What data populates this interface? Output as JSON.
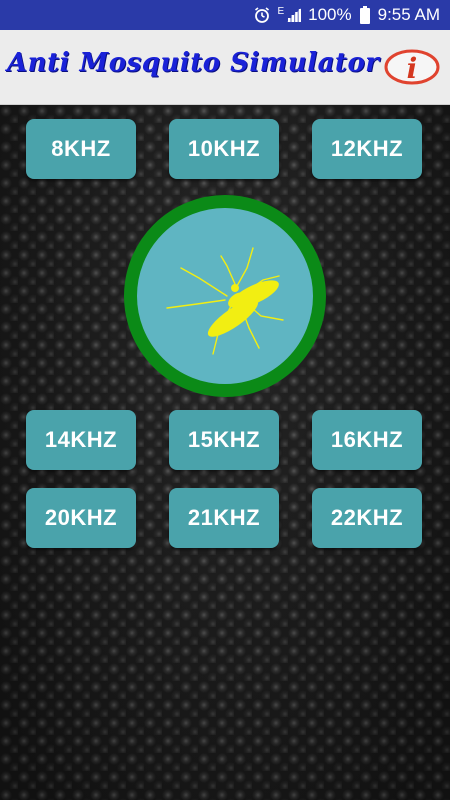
{
  "status_bar": {
    "battery_text": "100%",
    "time": "9:55 AM",
    "network_label": "E",
    "icons": [
      "alarm-icon",
      "network-e-icon",
      "signal-icon",
      "battery-icon"
    ]
  },
  "app_bar": {
    "title": "Anti Mosquito Simulator",
    "info_icon": "info-icon",
    "info_icon_glyph": "i"
  },
  "frequencies": {
    "row1": [
      "8KHZ",
      "10KHZ",
      "12KHZ"
    ],
    "row2": [
      "14KHZ",
      "15KHZ",
      "16KHZ"
    ],
    "row3": [
      "20KHZ",
      "21KHZ",
      "22KHZ"
    ]
  },
  "center_button": {
    "icon": "mosquito-icon"
  },
  "colors": {
    "status_bar": "#2a3aa8",
    "app_bar": "#ececec",
    "title": "#1a22d8",
    "button": "#4aa3ab",
    "ring": "#0b8a17",
    "circle_fill": "#5fb5c2",
    "mosquito": "#f2ee12",
    "info_red": "#e0432f"
  }
}
